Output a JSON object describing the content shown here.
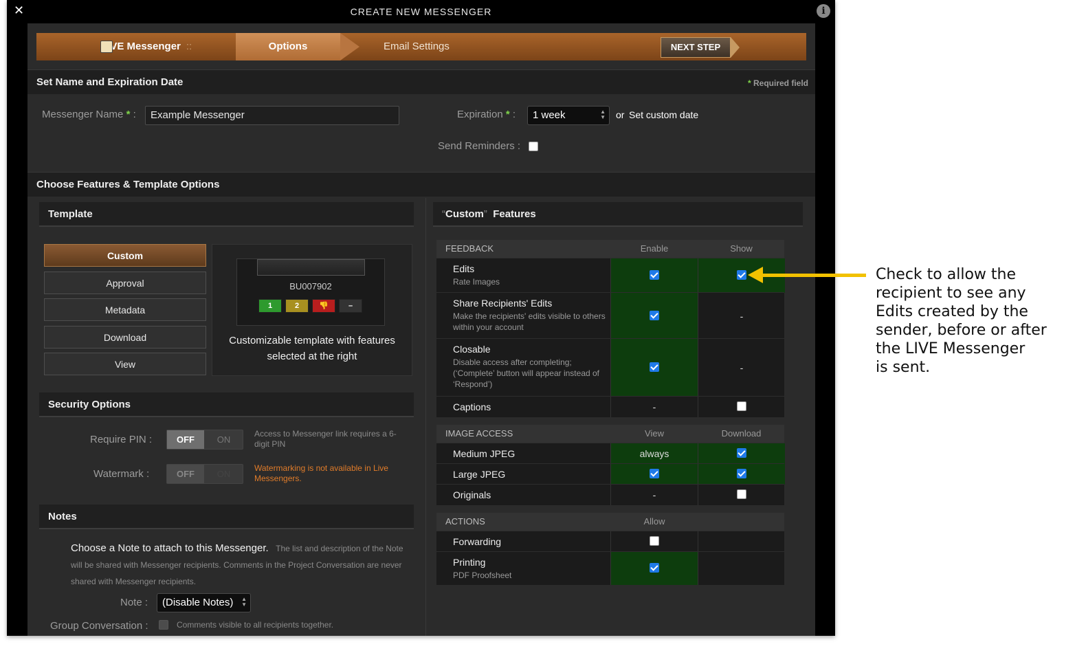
{
  "window": {
    "title": "CREATE NEW MESSENGER",
    "close_glyph": "✕",
    "info_glyph": "i"
  },
  "wizard": {
    "step1": "LIVE Messenger",
    "step1_sep": "::",
    "step2": "Options",
    "step3": "Email Settings",
    "next": "NEXT STEP"
  },
  "name_section": {
    "title": "Set Name and Expiration Date",
    "required_note": "Required field",
    "required_star": "*",
    "name_label": "Messenger Name",
    "name_value": "Example Messenger",
    "expiration_label": "Expiration",
    "expiration_value": "1 week",
    "or_text": "or",
    "custom_date_link": "Set custom date",
    "reminders_label": "Send Reminders :",
    "colon": ":"
  },
  "features_section": {
    "title": "Choose Features & Template Options"
  },
  "template": {
    "title": "Template",
    "buttons": [
      "Custom",
      "Approval",
      "Metadata",
      "Download",
      "View"
    ],
    "selected": "Custom",
    "preview_code": "BU007902",
    "preview_buttons": [
      "1",
      "2",
      "👎",
      "–"
    ],
    "description": "Customizable template with features selected at the right"
  },
  "security": {
    "title": "Security Options",
    "pin_label": "Require PIN :",
    "watermark_label": "Watermark :",
    "off": "OFF",
    "on": "ON",
    "pin_hint": "Access to Messenger link requires a 6-digit PIN",
    "watermark_hint": "Watermarking is not available in Live Messengers."
  },
  "notes": {
    "title": "Notes",
    "lead": "Choose a Note to attach to this Messenger.",
    "desc": "The list and description of the Note will be shared with Messenger recipients. Comments in the Project Conversation are never shared with Messenger recipients.",
    "note_label": "Note :",
    "note_value": "(Disable Notes)",
    "group_label": "Group Conversation :",
    "group_hint": "Comments visible to all recipients together."
  },
  "custom_features": {
    "title_open_quote": "“",
    "title_word": "Custom",
    "title_close_quote": "”",
    "title_rest": "Features",
    "feedback": {
      "header": "FEEDBACK",
      "col1": "Enable",
      "col2": "Show",
      "rows": [
        {
          "name": "Edits",
          "sub": "Rate Images",
          "enable": true,
          "show": true
        },
        {
          "name": "Share Recipients' Edits",
          "sub": "Make the recipients' edits visible to others within your account",
          "enable": true,
          "show": "-"
        },
        {
          "name": "Closable",
          "sub": "Disable access after completing; (‘Complete’ button will appear instead of ‘Respond’)",
          "enable": true,
          "show": "-"
        },
        {
          "name": "Captions",
          "sub": "",
          "enable": "-",
          "show": false
        }
      ]
    },
    "image_access": {
      "header": "IMAGE ACCESS",
      "col1": "View",
      "col2": "Download",
      "rows": [
        {
          "name": "Medium JPEG",
          "view": "always",
          "download": true
        },
        {
          "name": "Large JPEG",
          "view": true,
          "download": true
        },
        {
          "name": "Originals",
          "view": "-",
          "download": false
        }
      ]
    },
    "actions": {
      "header": "ACTIONS",
      "col1": "Allow",
      "rows": [
        {
          "name": "Forwarding",
          "sub": "",
          "allow": false
        },
        {
          "name": "Printing",
          "sub": "PDF Proofsheet",
          "allow": true
        }
      ]
    }
  },
  "annotation": {
    "text": "Check to allow the\nrecipient to see any\nEdits created by the\nsender, before or after\nthe LIVE Messenger\nis sent.",
    "arrow_color": "#f2c100"
  },
  "colors": {
    "accent_orange": "#a9642a",
    "enabled_green": "#0d3d0d",
    "checkbox_blue": "#1f7ae8",
    "required_star": "#7fd44a",
    "warning": "#e07c2a"
  }
}
